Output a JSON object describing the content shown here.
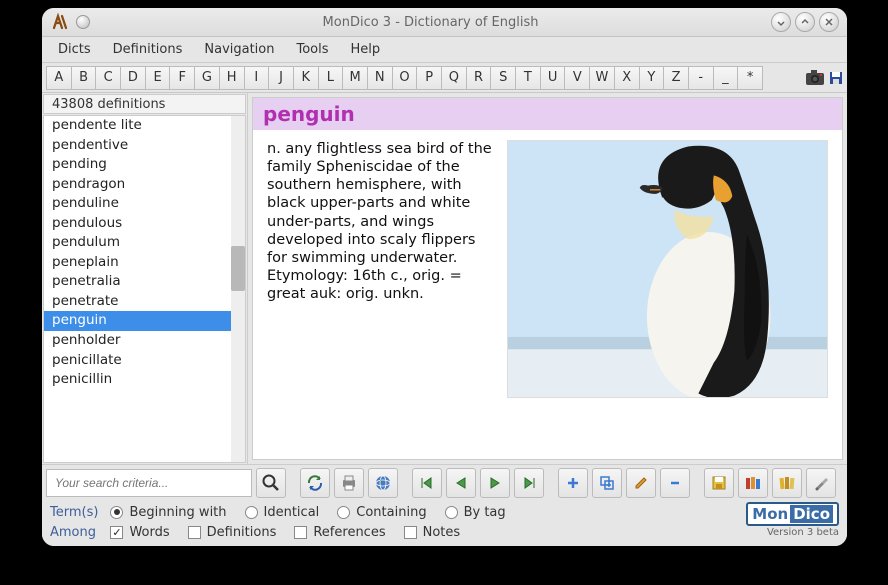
{
  "window": {
    "title": "MonDico 3 - Dictionary of English"
  },
  "menus": [
    "Dicts",
    "Definitions",
    "Navigation",
    "Tools",
    "Help"
  ],
  "alpha": [
    "A",
    "B",
    "C",
    "D",
    "E",
    "F",
    "G",
    "H",
    "I",
    "J",
    "K",
    "L",
    "M",
    "N",
    "O",
    "P",
    "Q",
    "R",
    "S",
    "T",
    "U",
    "V",
    "W",
    "X",
    "Y",
    "Z",
    "-",
    "_",
    "*"
  ],
  "sidebar": {
    "count": "43808 definitions",
    "words": [
      "pendente lite",
      "pendentive",
      "pending",
      "pendragon",
      "penduline",
      "pendulous",
      "pendulum",
      "peneplain",
      "penetralia",
      "penetrate",
      "penguin",
      "penholder",
      "penicillate",
      "penicillin"
    ],
    "selected_index": 10
  },
  "entry": {
    "headword": "penguin",
    "definition": "n. any flightless sea bird of the family Spheniscidae of the southern hemisphere, with black upper-parts and white under-parts, and wings developed into scaly flippers for swimming underwater.",
    "etymology": "Etymology: 16th c., orig. = great auk: orig. unkn."
  },
  "search": {
    "placeholder": "Your search criteria..."
  },
  "options": {
    "labels": {
      "terms": "Term(s)",
      "among": "Among"
    },
    "radios": [
      {
        "label": "Beginning with",
        "on": true
      },
      {
        "label": "Identical",
        "on": false
      },
      {
        "label": "Containing",
        "on": false
      },
      {
        "label": "By tag",
        "on": false
      }
    ],
    "checks": [
      {
        "label": "Words",
        "on": true
      },
      {
        "label": "Definitions",
        "on": false
      },
      {
        "label": "References",
        "on": false
      },
      {
        "label": "Notes",
        "on": false
      }
    ]
  },
  "logo": {
    "mon": "Mon",
    "dico": "Dico",
    "version": "Version 3 beta"
  }
}
